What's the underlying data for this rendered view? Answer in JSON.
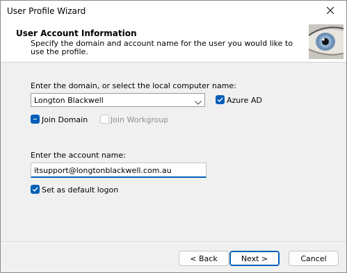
{
  "window": {
    "title": "User Profile Wizard"
  },
  "header": {
    "title": "User Account  Information",
    "description": "Specify the domain and account name for the user you would like to use the profile."
  },
  "domain": {
    "label": "Enter the domain, or select the local computer name:",
    "selected": "Longton Blackwell",
    "azure_ad_label": "Azure AD",
    "azure_ad_checked": true
  },
  "join": {
    "domain_label": "Join Domain",
    "workgroup_label": "Join Workgroup"
  },
  "account": {
    "label": "Enter the account name:",
    "value": "itsupport@longtonblackwell.com.au"
  },
  "default_logon": {
    "label": "Set as default logon",
    "checked": true
  },
  "buttons": {
    "back": "< Back",
    "next": "Next >",
    "cancel": "Cancel"
  },
  "icons": {
    "close": "close-icon",
    "eye": "eye-icon",
    "chevron": "chevron-down-icon",
    "check": "check-icon"
  },
  "colors": {
    "accent": "#005fb8"
  }
}
